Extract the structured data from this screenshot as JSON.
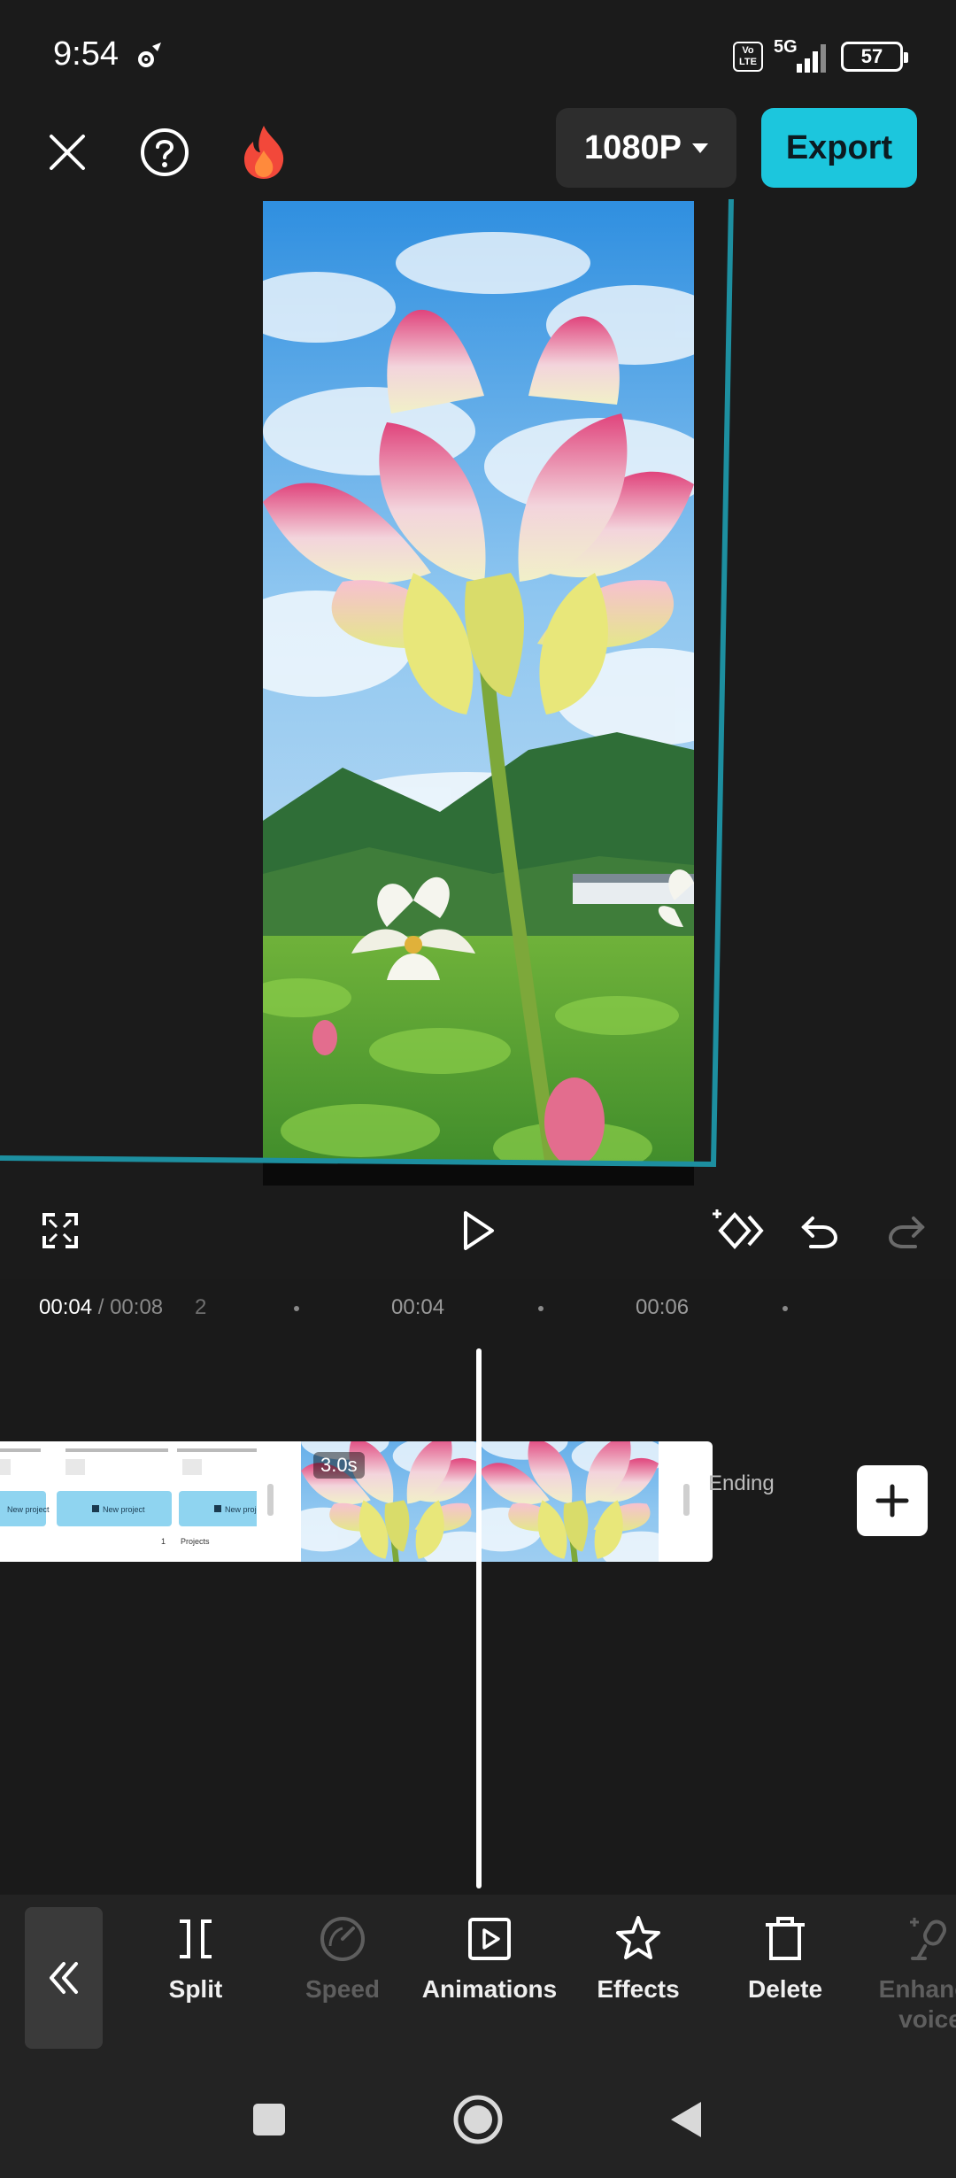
{
  "status_bar": {
    "time": "9:54",
    "volte_label": "Vo LTE",
    "network_label": "5G",
    "battery_level": "57"
  },
  "top_bar": {
    "resolution_label": "1080P",
    "export_label": "Export"
  },
  "timeline": {
    "current_time": "00:04",
    "separator": "/",
    "total_time": "00:08",
    "ruler_partial": "2",
    "ruler_labels": [
      "00:04",
      "00:06"
    ],
    "clip_duration": "3.0s",
    "ending_label": "Ending",
    "screenshot_frame_button": "New project",
    "screenshot_frame_heading": "Projects"
  },
  "toolbar": {
    "tools": [
      {
        "label": "Split",
        "enabled": true
      },
      {
        "label": "Speed",
        "enabled": false
      },
      {
        "label": "Animations",
        "enabled": true
      },
      {
        "label": "Effects",
        "enabled": true
      },
      {
        "label": "Delete",
        "enabled": true
      },
      {
        "label": "Enhance voice",
        "enabled": false
      }
    ]
  },
  "colors": {
    "accent": "#1cc6dd",
    "background": "#1b1b1b",
    "toolbar": "#232323",
    "transform_outline": "#1d8fa0"
  },
  "icons": [
    "gear-icon",
    "close-icon",
    "help-icon",
    "fire-icon",
    "chevron-down-icon",
    "fullscreen-icon",
    "play-icon",
    "keyframe-icon",
    "undo-icon",
    "redo-icon",
    "plus-icon",
    "double-chevron-left-icon",
    "split-icon",
    "speed-icon",
    "animations-icon",
    "effects-icon",
    "delete-icon",
    "enhance-voice-icon",
    "stop-icon",
    "home-icon",
    "back-icon"
  ]
}
